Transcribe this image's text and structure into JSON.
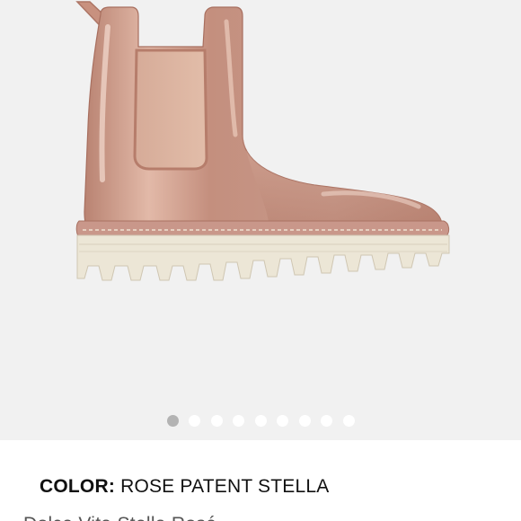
{
  "product": {
    "color_label": "COLOR:",
    "color_value": "ROSE PATENT STELLA",
    "cutoff_text": "Dolce Vita Stella Rosé"
  },
  "carousel": {
    "total_slides": 9,
    "active_index": 0
  },
  "colors": {
    "gallery_bg": "#f1f1f1",
    "boot": "#c79886",
    "sole": "#ece6d6",
    "dot_active": "#b3b3b3",
    "dot_inactive": "#ffffff"
  },
  "icons": {
    "product_image": "rain-boot-illustration"
  }
}
